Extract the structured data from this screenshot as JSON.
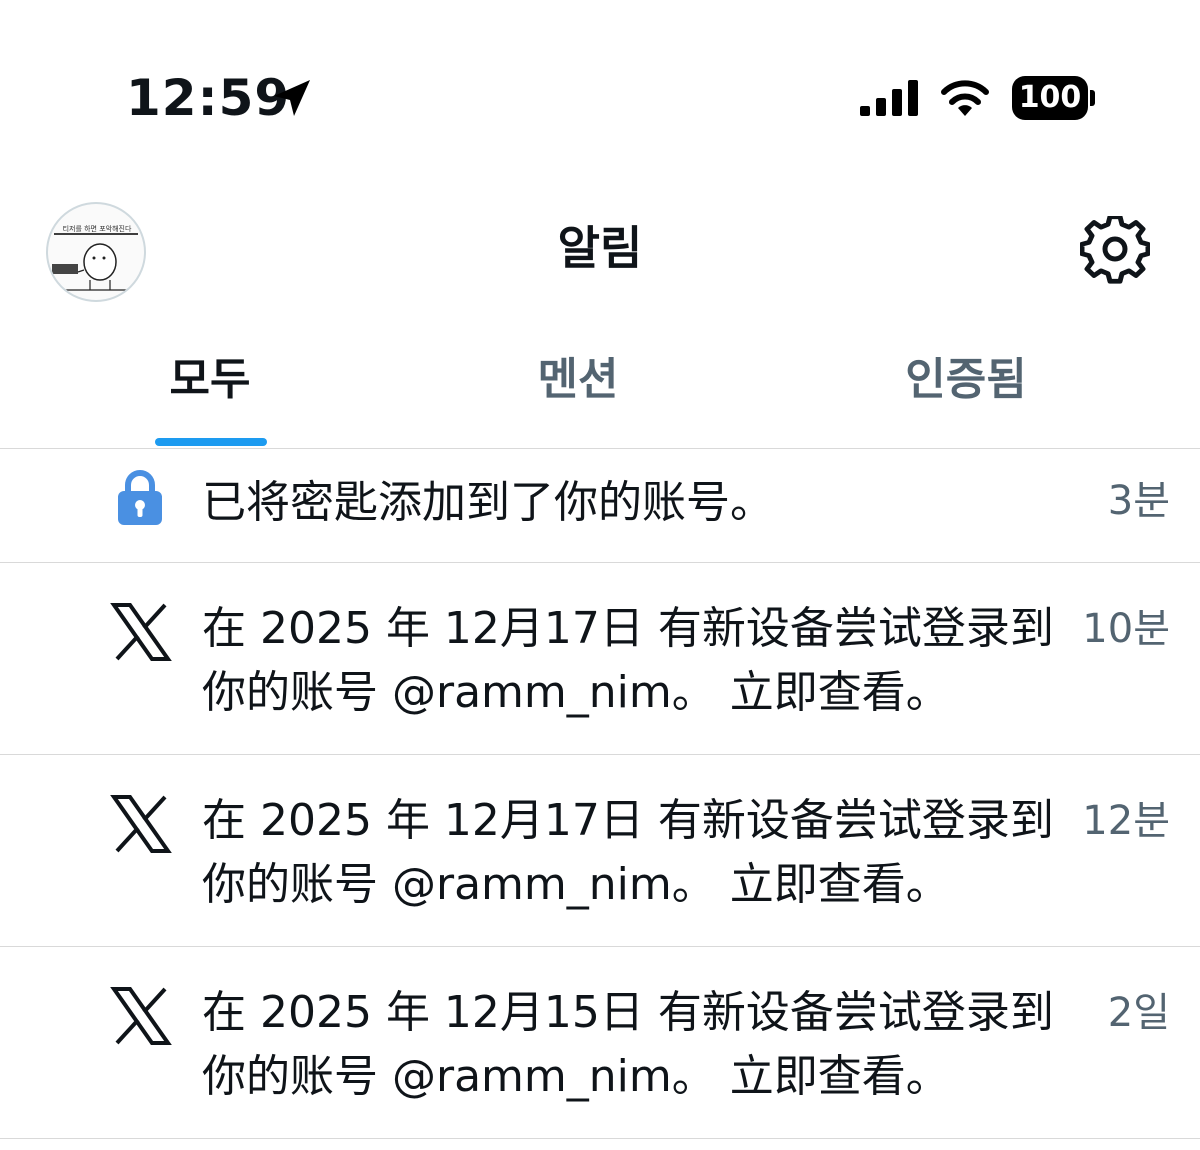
{
  "status_bar": {
    "time": "12:59",
    "battery": "100"
  },
  "header": {
    "title": "알림",
    "avatar_caption": "티저를 하면 포악해진다"
  },
  "tabs": [
    {
      "label": "모두",
      "active": true
    },
    {
      "label": "멘션",
      "active": false
    },
    {
      "label": "인증됨",
      "active": false
    }
  ],
  "notifications": [
    {
      "icon": "lock-icon",
      "text": "已将密匙添加到了你的账号。",
      "time": "3분"
    },
    {
      "icon": "x-logo-icon",
      "text": "在 2025 年 12月17日 有新设备尝试登录到你的账号 @ramm_nim。 立即查看。",
      "time": "10분"
    },
    {
      "icon": "x-logo-icon",
      "text": "在 2025 年 12月17日 有新设备尝试登录到你的账号 @ramm_nim。 立即查看。",
      "time": "12분"
    },
    {
      "icon": "x-logo-icon",
      "text": "在 2025 年 12月15日 有新设备尝试登录到你的账号 @ramm_nim。 立即查看。",
      "time": "2일"
    }
  ],
  "colors": {
    "accent": "#1d9bf0",
    "lock_icon": "#4a90e2",
    "secondary_text": "#536471"
  }
}
